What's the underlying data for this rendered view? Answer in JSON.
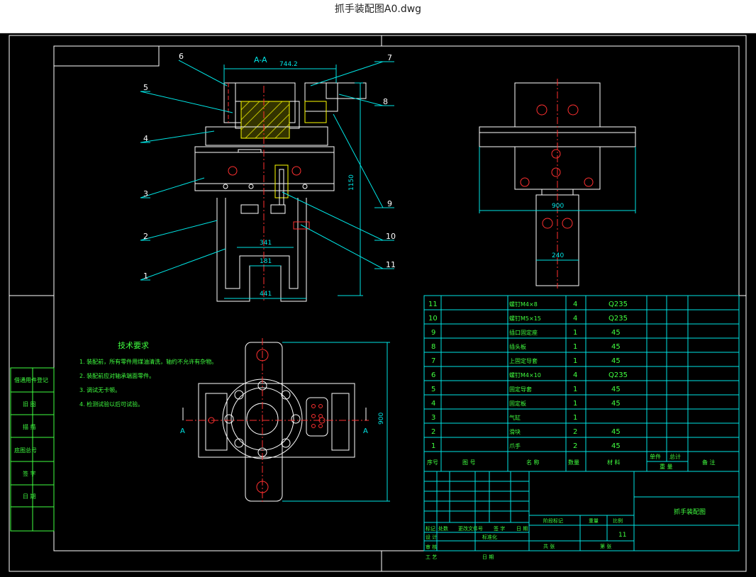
{
  "window": {
    "title": "抓手装配图A0.dwg"
  },
  "drawing": {
    "section_label": "A-A",
    "view_arrow_label": "A",
    "dimensions": {
      "top_width": "744.2",
      "total_height": "1150",
      "inner_width": "341",
      "slot_width": "181",
      "base_width": "441",
      "side_width": "900",
      "stem_width": "240",
      "plan_height": "900"
    },
    "callouts": [
      "1",
      "2",
      "3",
      "4",
      "5",
      "6",
      "7",
      "8",
      "9",
      "10",
      "11"
    ],
    "tech_title": "技术要求",
    "tech_notes": [
      "1. 装配前，所有零件用煤油清洗，轴约不允许有杂物。",
      "2. 装配前应对轴承端面零件。",
      "3. 调试无卡顿。",
      "4. 检测试验以后可试验。"
    ],
    "side_stamps": [
      "借通用件登记",
      "旧 图",
      "描 描",
      "底图总号",
      "签 字",
      "日 期"
    ]
  },
  "bom": {
    "rows": [
      {
        "no": "11",
        "name": "螺钉M4×8",
        "qty": "4",
        "material": "Q235"
      },
      {
        "no": "10",
        "name": "螺钉M5×15",
        "qty": "4",
        "material": "Q235"
      },
      {
        "no": "9",
        "name": "插口固定座",
        "qty": "1",
        "material": "45"
      },
      {
        "no": "8",
        "name": "插头板",
        "qty": "1",
        "material": "45"
      },
      {
        "no": "7",
        "name": "上固定导套",
        "qty": "1",
        "material": "45"
      },
      {
        "no": "6",
        "name": "螺钉M4×10",
        "qty": "4",
        "material": "Q235"
      },
      {
        "no": "5",
        "name": "固定导套",
        "qty": "1",
        "material": "45"
      },
      {
        "no": "4",
        "name": "固定板",
        "qty": "1",
        "material": "45"
      },
      {
        "no": "3",
        "name": "气缸",
        "qty": "1",
        "material": ""
      },
      {
        "no": "2",
        "name": "滑块",
        "qty": "2",
        "material": "45"
      },
      {
        "no": "1",
        "name": "爪手",
        "qty": "2",
        "material": "45"
      }
    ],
    "header": {
      "no": "序号",
      "code": "图 号",
      "name": "名 称",
      "qty": "数量",
      "material": "材 料",
      "single": "单件",
      "total": "总计",
      "weight": "重 量",
      "remark": "备 注"
    }
  },
  "title_block": {
    "drawing_name": "抓手装配图",
    "sheet_count": "11",
    "labels": [
      "标记",
      "处数",
      "更改文件号",
      "签 字",
      "日 期",
      "设 计",
      "标准化",
      "审 核",
      "工 艺",
      "日 期",
      "阶段标记",
      "重量",
      "比例",
      "共 张",
      "第 张"
    ]
  },
  "colors": {
    "line": "#ffffff",
    "dim": "#00e5e5",
    "accent": "#ff3030",
    "hatch": "#ffff00",
    "green": "#40ff40",
    "bg": "#000000"
  }
}
